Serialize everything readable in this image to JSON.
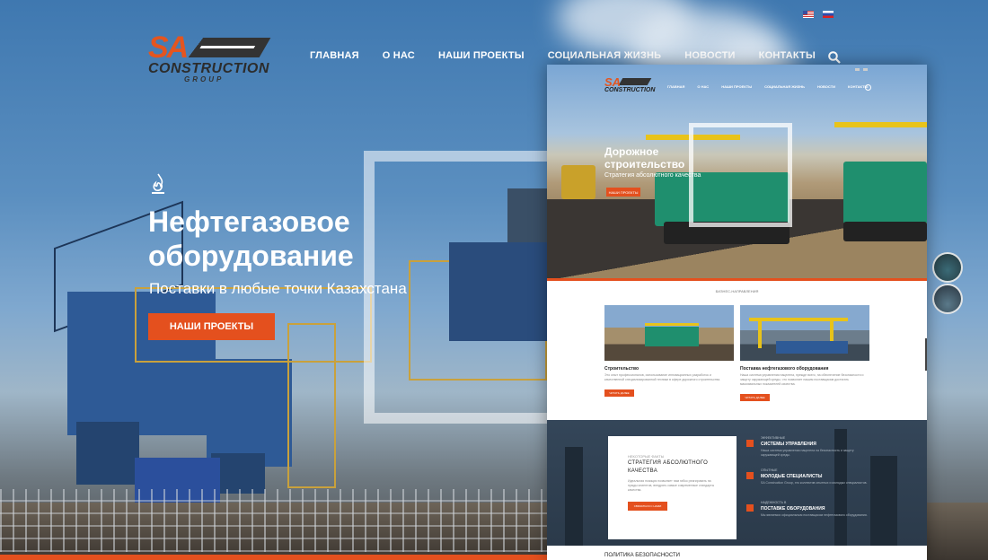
{
  "header": {
    "logo": {
      "mark": "SA",
      "name": "CONSTRUCTION",
      "tag": "GROUP"
    },
    "nav": [
      {
        "label": "ГЛАВНАЯ"
      },
      {
        "label": "О НАС"
      },
      {
        "label": "НАШИ ПРОЕКТЫ"
      },
      {
        "label": "СОЦИАЛЬНАЯ ЖИЗНЬ"
      },
      {
        "label": "НОВОСТИ"
      },
      {
        "label": "КОНТАКТЫ"
      }
    ],
    "languages": [
      "en",
      "ru"
    ],
    "search_icon": "search-icon"
  },
  "hero": {
    "icon": "flame-icon",
    "title": "Нефтегазовое оборудование",
    "subtitle": "Поставки в любые точки Казахстана",
    "button_label": "НАШИ ПРОЕКТЫ"
  },
  "mockup": {
    "logo": {
      "mark": "SA",
      "name": "CONSTRUCTION"
    },
    "nav": [
      "ГЛАВНАЯ",
      "О НАС",
      "НАШИ ПРОЕКТЫ",
      "СОЦИАЛЬНАЯ ЖИЗНЬ",
      "НОВОСТИ",
      "КОНТАКТЫ"
    ],
    "hero_title": "Дорожное строительство",
    "hero_subtitle": "Стратегия абсолютного качества",
    "hero_button": "НАШИ ПРОЕКТЫ",
    "section_label": "БИЗНЕС-НАПРАВЛЕНИЯ",
    "cards": [
      {
        "title": "Строительство",
        "text": "Это опыт профессионалов, использование инновационных разработок и качественной специализированной техники в сфере дорожного строительства.",
        "button": "ЧИТАТЬ ДАЛЕЕ"
      },
      {
        "title": "Поставка нефтегазового оборудования",
        "text": "Наша система управления нацелена, прежде всего, на обеспечение безопасности и защиту окружающей среды, что позволяет нашим поставщикам достигать максимальных показателей качества.",
        "button": "ЧИТАТЬ ДАЛЕЕ"
      }
    ],
    "feature_card": {
      "small": "НЕКОТОРЫЕ ФАКТЫ",
      "title": "СТРАТЕГИЯ АБСОЛЮТНОГО КАЧЕСТВА",
      "text": "Идеальная позиция позволяет нам гибко реагировать на нужды клиентов, внедрять самые современные стандарты качества.",
      "button": "СВЯЗАТЬСЯ С НАМИ"
    },
    "features": [
      {
        "small": "ЭФФЕКТИВНЫЕ",
        "title": "СИСТЕМЫ УПРАВЛЕНИЯ",
        "text": "Наша система управления нацелена на безопасность и защиту окружающей среды."
      },
      {
        "small": "ОПЫТНЫЕ",
        "title": "МОЛОДЫЕ СПЕЦИАЛИСТЫ",
        "text": "SA Construction Group, это коллектив опытных и молодых специалистов."
      },
      {
        "small": "НАДЕЖНОСТЬ В",
        "title": "ПОСТАВКЕ ОБОРУДОВАНИЯ",
        "text": "Мы являемся официальным поставщиком нефтегазового оборудования."
      }
    ],
    "bottom_heading": "ПОЛИТИКА БЕЗОПАСНОСТИ"
  },
  "slider_thumbs": [
    "slide-thumb-1",
    "slide-thumb-2"
  ],
  "colors": {
    "accent": "#e4501e",
    "logo_orange": "#e4551f",
    "plant_blue": "#2e5a96",
    "paver_green": "#1f8f6e"
  }
}
